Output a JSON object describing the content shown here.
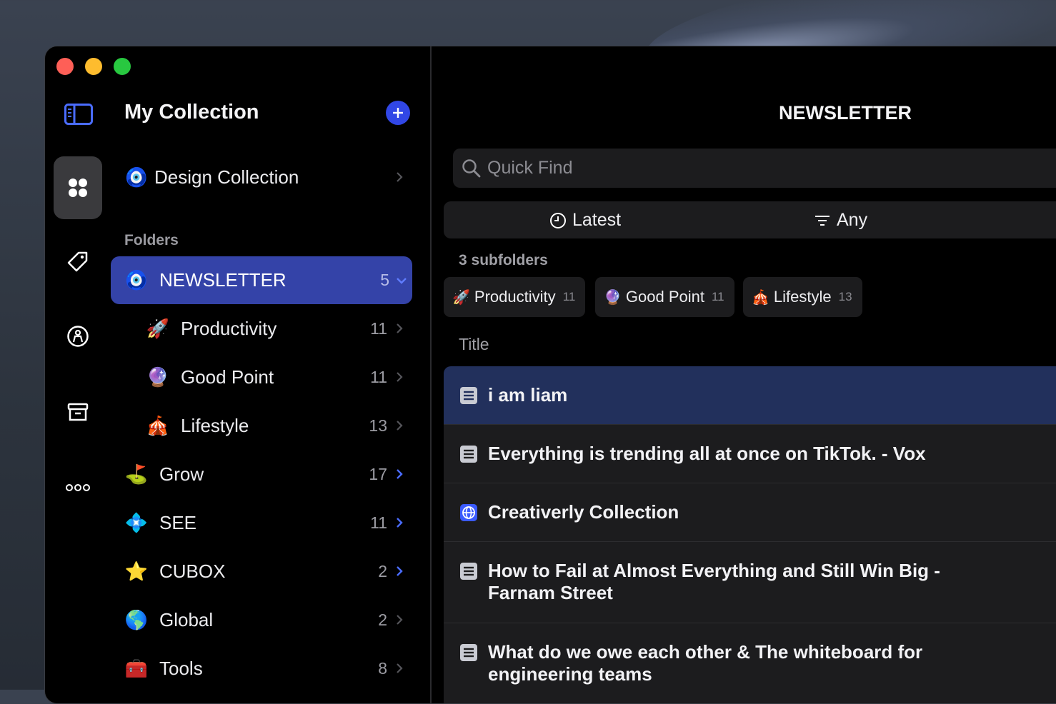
{
  "window": {
    "controls": [
      "close",
      "minimize",
      "zoom"
    ]
  },
  "rail": {
    "items": [
      "sidebar-toggle-icon",
      "collections-icon",
      "tag-icon",
      "person-icon",
      "archive-icon",
      "more-icon"
    ]
  },
  "sidebar": {
    "title": "My Collection",
    "add_icon": "plus-icon",
    "design_collection": {
      "emoji": "🧿",
      "label": "Design Collection"
    },
    "folders_header": "Folders",
    "newsletter": {
      "emoji": "🧿",
      "label": "NEWSLETTER",
      "count": "5"
    },
    "subfolders": [
      {
        "emoji": "🚀",
        "label": "Productivity",
        "count": "11"
      },
      {
        "emoji": "🔮",
        "label": "Good Point",
        "count": "11"
      },
      {
        "emoji": "🎪",
        "label": "Lifestyle",
        "count": "13"
      }
    ],
    "folders": [
      {
        "emoji": "⛳",
        "label": "Grow",
        "count": "17"
      },
      {
        "emoji": "💠",
        "label": "SEE",
        "count": "11"
      },
      {
        "emoji": "⭐",
        "label": "CUBOX",
        "count": "2"
      },
      {
        "emoji": "🌎",
        "label": "Global",
        "count": "2"
      },
      {
        "emoji": "🧰",
        "label": "Tools",
        "count": "8"
      }
    ]
  },
  "main": {
    "title": "NEWSLETTER",
    "search_placeholder": "Quick Find",
    "sort_label": "Latest",
    "filter_label": "Any",
    "subfolders_header": "3 subfolders",
    "chips": [
      {
        "emoji": "🚀",
        "label": "Productivity",
        "count": "11"
      },
      {
        "emoji": "🔮",
        "label": "Good Point",
        "count": "11"
      },
      {
        "emoji": "🎪",
        "label": "Lifestyle",
        "count": "13"
      }
    ],
    "column_title": "Title",
    "items": [
      {
        "icon": "article-icon",
        "title": "i am liam"
      },
      {
        "icon": "article-icon",
        "title": "Everything is trending all at once on TikTok. - Vox"
      },
      {
        "icon": "globe-icon",
        "title": "Creativerly Collection"
      },
      {
        "icon": "article-icon",
        "title": "How to Fail at Almost Everything and Still Win Big - Farnam Street"
      },
      {
        "icon": "article-icon",
        "title": "What do we owe each other & The whiteboard for engineering teams"
      }
    ]
  },
  "colors": {
    "accent": "#3147e6",
    "selected_folder": "#3443a8",
    "selected_item": "#22305c",
    "background": "#000000"
  }
}
